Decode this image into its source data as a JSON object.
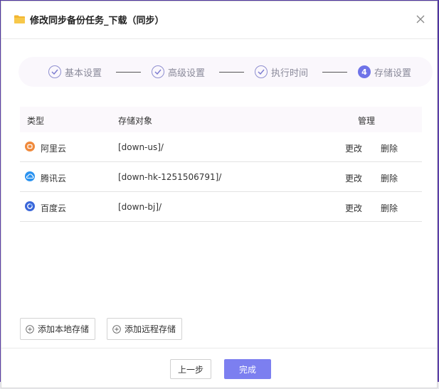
{
  "dialog": {
    "title": "修改同步备份任务_下载（同步）"
  },
  "steps": [
    {
      "label": "基本设置",
      "state": "done"
    },
    {
      "label": "高级设置",
      "state": "done"
    },
    {
      "label": "执行时间",
      "state": "done"
    },
    {
      "label": "存储设置",
      "state": "active",
      "number": "4"
    }
  ],
  "table": {
    "headers": {
      "type": "类型",
      "target": "存储对象",
      "manage": "管理"
    },
    "rows": [
      {
        "provider": "阿里云",
        "icon": "aliyun-icon",
        "icon_color": "#f08a3c",
        "target": "[down-us]/",
        "edit": "更改",
        "delete": "删除"
      },
      {
        "provider": "腾讯云",
        "icon": "tencent-cloud-icon",
        "icon_color": "#2b93f0",
        "target": "[down-hk-1251506791]/",
        "edit": "更改",
        "delete": "删除"
      },
      {
        "provider": "百度云",
        "icon": "baidu-cloud-icon",
        "icon_color": "#3b67d9",
        "target": "[down-bj]/",
        "edit": "更改",
        "delete": "删除"
      }
    ]
  },
  "actions": {
    "add_local": "添加本地存储",
    "add_remote": "添加远程存储",
    "prev": "上一步",
    "done": "完成"
  },
  "colors": {
    "accent": "#7c7ff0",
    "step_active": "#6f73e8"
  }
}
